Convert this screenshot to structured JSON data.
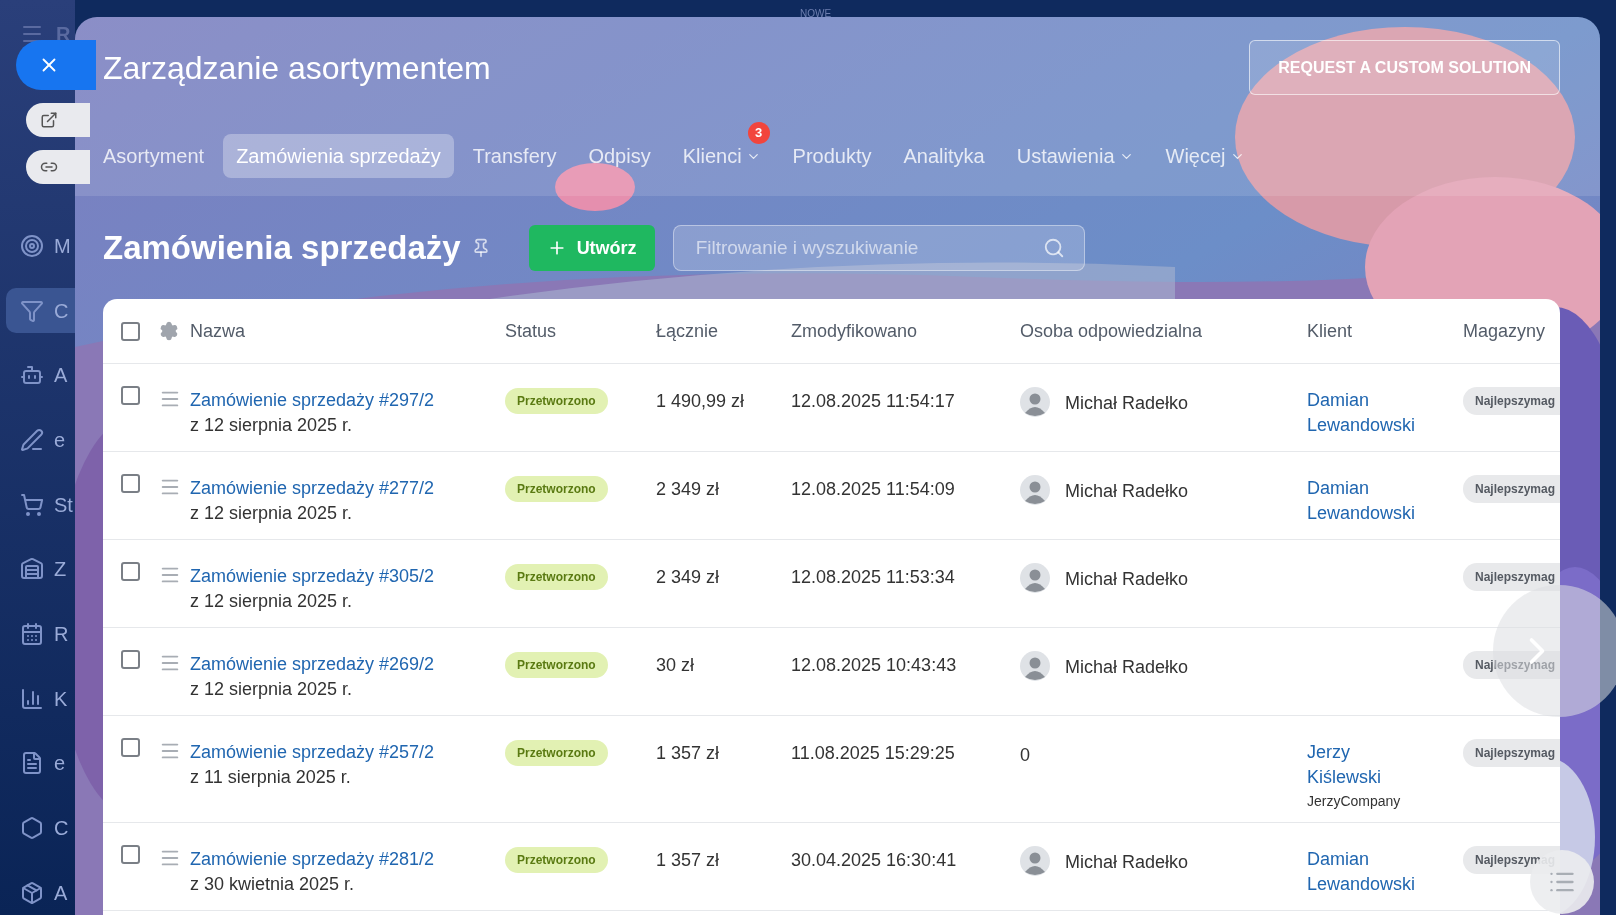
{
  "desktop": {
    "menu_letter": "R",
    "top_label": "NOWE"
  },
  "sidebar": {
    "items": [
      {
        "label": "M",
        "selected": false
      },
      {
        "label": "C",
        "selected": true
      },
      {
        "label": "A",
        "selected": false
      },
      {
        "label": "e",
        "selected": false
      },
      {
        "label": "St",
        "selected": false
      },
      {
        "label": "Z",
        "selected": false
      },
      {
        "label": "R",
        "selected": false
      },
      {
        "label": "K",
        "selected": false
      },
      {
        "label": "e",
        "selected": false
      },
      {
        "label": "C",
        "selected": false
      },
      {
        "label": "A",
        "selected": false
      }
    ]
  },
  "window": {
    "title": "Zarządzanie asortymentem",
    "action": "REQUEST A CUSTOM SOLUTION"
  },
  "tabs": [
    {
      "label": "Asortyment",
      "selected": false,
      "menu": false
    },
    {
      "label": "Zamówienia sprzedaży",
      "selected": true,
      "menu": false
    },
    {
      "label": "Transfery",
      "selected": false,
      "menu": false
    },
    {
      "label": "Odpisy",
      "selected": false,
      "menu": false
    },
    {
      "label": "Klienci",
      "selected": false,
      "menu": true,
      "badge": "3"
    },
    {
      "label": "Produkty",
      "selected": false,
      "menu": false
    },
    {
      "label": "Analityka",
      "selected": false,
      "menu": false
    },
    {
      "label": "Ustawienia",
      "selected": false,
      "menu": true
    },
    {
      "label": "Więcej",
      "selected": false,
      "menu": true
    }
  ],
  "page": {
    "heading": "Zamówienia sprzedaży",
    "create_button": "Utwórz",
    "search": {
      "placeholder": "Filtrowanie i wyszukiwanie"
    }
  },
  "table": {
    "select_all": {
      "checked": false
    },
    "columns": [
      "Nazwa",
      "Status",
      "Łącznie",
      "Zmodyfikowano",
      "Osoba odpowiedzialna",
      "Klient",
      "Magazyny"
    ],
    "rows": [
      {
        "checked": false,
        "name": "Zamówienie sprzedaży #297/2",
        "date": "z 12 sierpnia 2025 r.",
        "status": "Przetworzono",
        "total": "1 490,99 zł",
        "modified": "12.08.2025 11:54:17",
        "person": {
          "name": "Michał Radełko",
          "avatar": true
        },
        "client": [
          "Damian",
          "Lewandowski"
        ],
        "warehouse": "Najlepszymag"
      },
      {
        "checked": false,
        "name": "Zamówienie sprzedaży #277/2",
        "date": "z 12 sierpnia 2025 r.",
        "status": "Przetworzono",
        "total": "2 349 zł",
        "modified": "12.08.2025 11:54:09",
        "person": {
          "name": "Michał Radełko",
          "avatar": true
        },
        "client": [
          "Damian",
          "Lewandowski"
        ],
        "warehouse": "Najlepszymag"
      },
      {
        "checked": false,
        "name": "Zamówienie sprzedaży #305/2",
        "date": "z 12 sierpnia 2025 r.",
        "status": "Przetworzono",
        "total": "2 349 zł",
        "modified": "12.08.2025 11:53:34",
        "person": {
          "name": "Michał Radełko",
          "avatar": true
        },
        "warehouse": "Najlepszymag"
      },
      {
        "checked": false,
        "name": "Zamówienie sprzedaży #269/2",
        "date": "z 12 sierpnia 2025 r.",
        "status": "Przetworzono",
        "total": "30 zł",
        "modified": "12.08.2025 10:43:43",
        "person": {
          "name": "Michał Radełko",
          "avatar": true
        },
        "warehouse": "Najlepszymag"
      },
      {
        "checked": false,
        "name": "Zamówienie sprzedaży #257/2",
        "date": "z 11 sierpnia 2025 r.",
        "status": "Przetworzono",
        "total": "1 357 zł",
        "modified": "11.08.2025 15:29:25",
        "person": {
          "name": "0",
          "avatar": false
        },
        "client": [
          "Jerzy",
          "Kiślewski"
        ],
        "client_company": "JerzyCompany",
        "warehouse": "Najlepszymag"
      },
      {
        "checked": false,
        "name": "Zamówienie sprzedaży #281/2",
        "date": "z 30 kwietnia 2025 r.",
        "status": "Przetworzono",
        "total": "1 357 zł",
        "modified": "30.04.2025 16:30:41",
        "person": {
          "name": "Michał Radełko",
          "avatar": true
        },
        "client": [
          "Damian",
          "Lewandowski"
        ],
        "warehouse": "Najlepszymag"
      }
    ]
  }
}
